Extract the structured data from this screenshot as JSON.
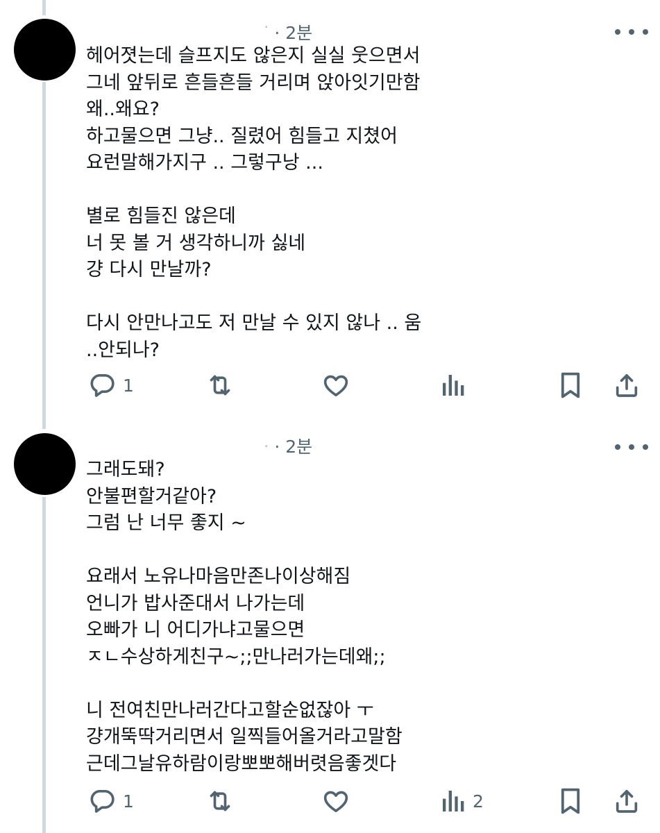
{
  "tweets": [
    {
      "author_blurred": "ᐝ",
      "sep": " · ",
      "time": "2분",
      "lines": [
        "헤어졋는데 슬프지도 않은지 실실 웃으면서",
        "그네 앞뒤로 흔들흔들 거리며 앉아잇기만함",
        "왜..왜요?",
        "하고물으면 그냥.. 질렸어 힘들고 지쳤어",
        "요런말해가지구 .. 그렇구낭 ...",
        "",
        "별로 힘들진 않은데",
        "너 못 볼 거 생각하니까 싫네",
        "걍 다시 만날까?",
        "",
        "다시 안만나고도 저 만날 수 있지 않나 .. 움",
        "..안되나?"
      ],
      "reply_count": "1",
      "retweet_count": "",
      "like_count": "",
      "view_count": ""
    },
    {
      "author_blurred": "ᐧ",
      "sep": " · ",
      "time": "2분",
      "lines": [
        "그래도돼?",
        "안불편할거같아?",
        "그럼 난 너무 좋지 ~",
        "",
        "요래서 노유나마음만존나이상해짐",
        "언니가 밥사준대서 나가는데",
        "오빠가 니 어디가냐고물으면",
        "ㅈㄴ수상하게친구~;;만나러가는데왜;;",
        "",
        "니 전여친만나러간다고할순없잖아 ㅜ",
        "걍개뚝딱거리면서 일찍들어올거라고말함",
        "근데그날유하람이랑뽀뽀해버렷음좋겟다"
      ],
      "reply_count": "1",
      "retweet_count": "",
      "like_count": "",
      "view_count": "2"
    }
  ],
  "icons": {
    "reply": "reply-icon",
    "retweet": "retweet-icon",
    "like": "like-icon",
    "views": "views-icon",
    "bookmark": "bookmark-icon",
    "share": "share-icon",
    "more": "more-icon"
  },
  "colors": {
    "text": "#0f1419",
    "secondary": "#536471",
    "thread_line": "#cfd9de",
    "avatar": "#000000"
  }
}
